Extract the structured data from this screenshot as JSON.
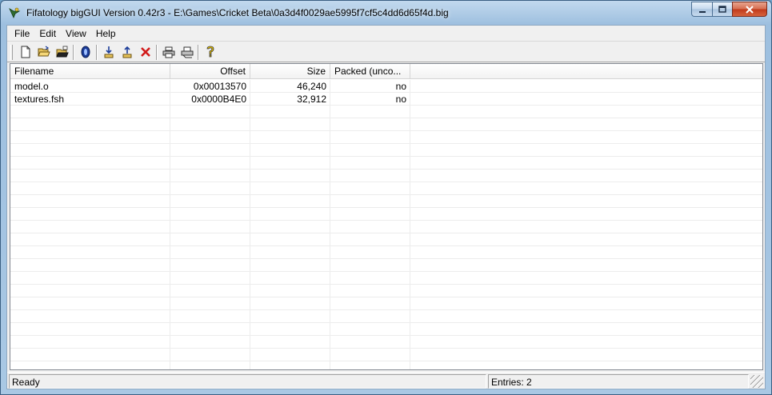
{
  "window": {
    "title": "Fifatology bigGUI Version 0.42r3  - E:\\Games\\Cricket Beta\\0a3d4f0029ae5995f7cf5c4dd6d65f4d.big"
  },
  "menu": [
    "File",
    "Edit",
    "View",
    "Help"
  ],
  "toolbar": {
    "icons": [
      "new-file-icon",
      "open-folder-icon",
      "open-recent-icon",
      "globe-icon",
      "extract-icon",
      "import-icon",
      "delete-icon",
      "print-icon",
      "print-preview-icon",
      "help-icon"
    ],
    "accent_red": "#d11a1a",
    "accent_blue": "#1b3c99",
    "accent_yellow": "#e8c200"
  },
  "list": {
    "columns": [
      "Filename",
      "Offset",
      "Size",
      "Packed (unco..."
    ],
    "rows": [
      {
        "filename": "model.o",
        "offset": "0x00013570",
        "size": "46,240",
        "packed": "no"
      },
      {
        "filename": "textures.fsh",
        "offset": "0x0000B4E0",
        "size": "32,912",
        "packed": "no"
      }
    ]
  },
  "status": {
    "text": "Ready",
    "entries": "Entries: 2"
  }
}
